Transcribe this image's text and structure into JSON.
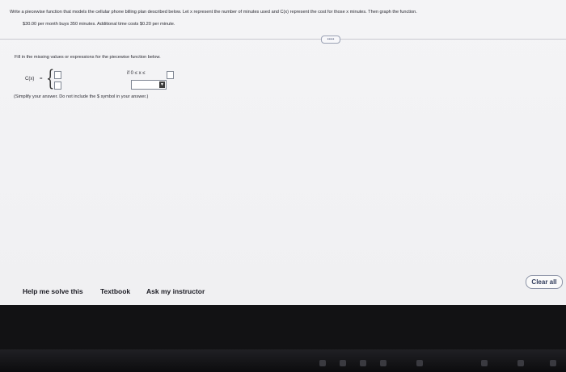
{
  "question": {
    "line1": "Write a piecewise function that models the cellular phone billing plan described below. Let x represent the number of minutes used and C(x) represent the cost for those x minutes. Then graph the function.",
    "line2": "$30.00 per month buys 350 minutes. Additional time costs $0.20 per minute."
  },
  "more_button": "•••••",
  "instruction": "Fill in the missing values or expressions for the piecewise function below.",
  "function": {
    "label": "C(x)",
    "equals": "=",
    "brace": "{",
    "condition_prefix": "if 0 ≤ x ≤"
  },
  "select": {
    "caret": "▼"
  },
  "simplify_note": "(Simplify your answer. Do not include the $ symbol in your answer.)",
  "footer": {
    "help": "Help me solve this",
    "textbook": "Textbook",
    "ask": "Ask my instructor",
    "clear": "Clear all"
  }
}
